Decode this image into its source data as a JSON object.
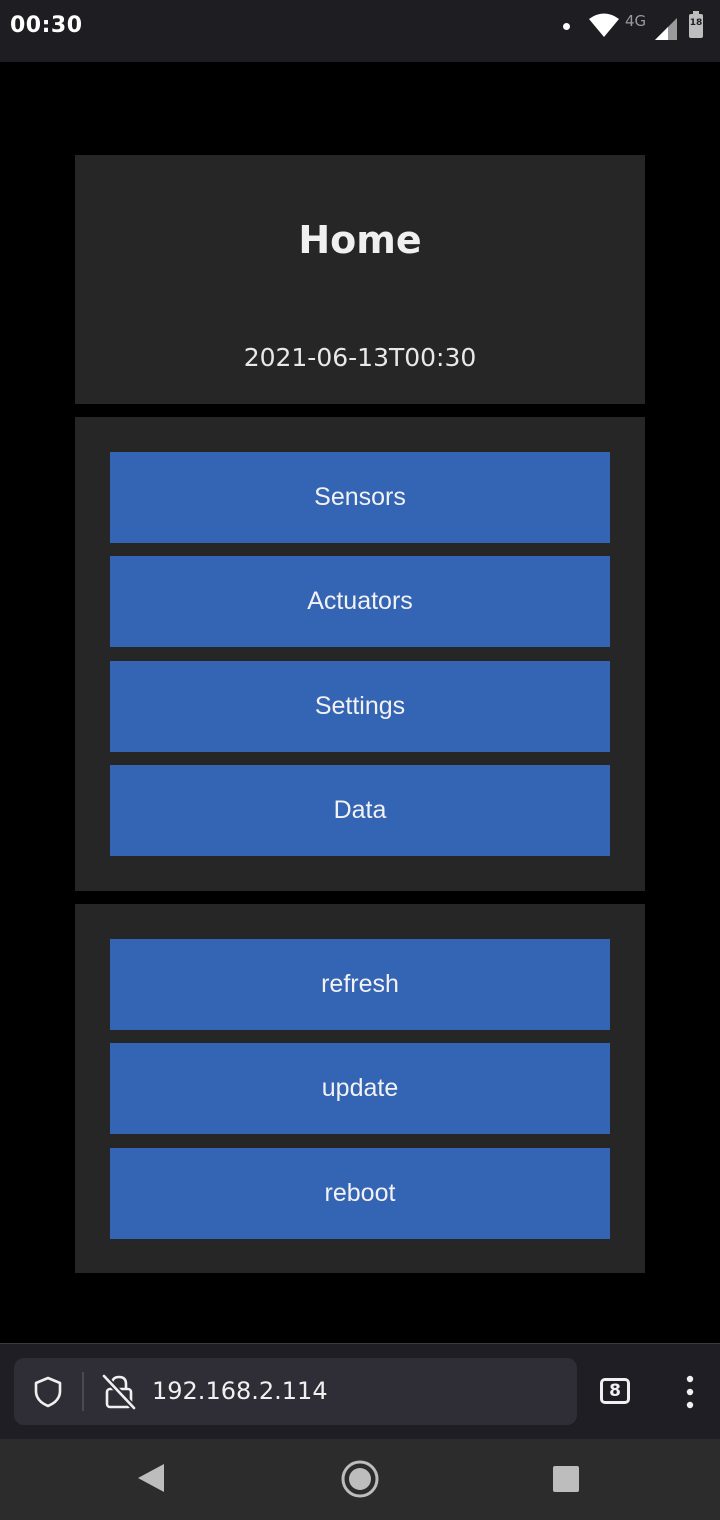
{
  "status_bar": {
    "time": "00:30",
    "network": "4G",
    "battery": "18"
  },
  "header": {
    "title": "Home",
    "timestamp": "2021-06-13T00:30"
  },
  "nav_buttons": [
    {
      "label": "Sensors"
    },
    {
      "label": "Actuators"
    },
    {
      "label": "Settings"
    },
    {
      "label": "Data"
    }
  ],
  "action_buttons": [
    {
      "label": "refresh"
    },
    {
      "label": "update"
    },
    {
      "label": "reboot"
    }
  ],
  "browser": {
    "url": "192.168.2.114",
    "tab_count": "8"
  },
  "icons": {
    "status": [
      "wifi-icon",
      "signal-icon",
      "battery-icon"
    ],
    "browser": [
      "shield-icon",
      "lock-off-icon",
      "tabs-counter",
      "menu-icon"
    ],
    "navigation": [
      "back-icon",
      "home-icon",
      "recents-icon"
    ]
  },
  "colors": {
    "background": "#000000",
    "panel": "#262626",
    "button": "#3464b4",
    "status_bar": "#1e1e22"
  }
}
